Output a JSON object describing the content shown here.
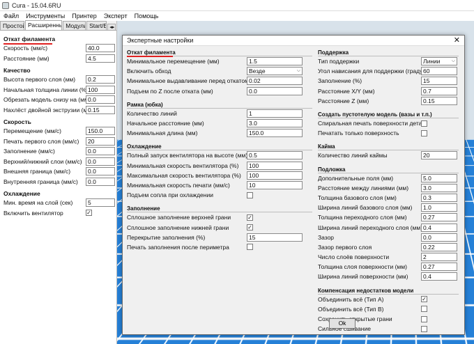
{
  "window": {
    "title": "Cura - 15.04.6RU"
  },
  "menu": [
    "Файл",
    "Инструменты",
    "Принтер",
    "Эксперт",
    "Помощь"
  ],
  "left_panel": {
    "tabs": [
      "Простой",
      "Расширенный",
      "Модули",
      "Start/E"
    ],
    "tab_arrows": "◂▸",
    "sections": [
      {
        "title": "Откат филамента",
        "rows": [
          {
            "label": "Скорость (мм/с)",
            "value": "40.0"
          },
          {
            "label": "Расстояние (мм)",
            "value": "4.5"
          }
        ]
      },
      {
        "title": "Качество",
        "rows": [
          {
            "label": "Высота первого слоя (мм)",
            "value": "0.2"
          },
          {
            "label": "Начальная толщина линии (%)",
            "value": "100"
          },
          {
            "label": "Обрезать модель снизу на (мм)",
            "value": "0.0"
          },
          {
            "label": "Нахлёст двойной экструзии (мм)",
            "value": "0.15"
          }
        ]
      },
      {
        "title": "Скорость",
        "rows": [
          {
            "label": "Перемещение (мм/с)",
            "value": "150.0"
          },
          {
            "label": "Печать первого слоя (мм/с)",
            "value": "20"
          },
          {
            "label": "Заполнение (мм/с)",
            "value": "0.0"
          },
          {
            "label": "Верхний/нижний слои (мм/с)",
            "value": "0.0"
          },
          {
            "label": "Внешняя граница (мм/с)",
            "value": "0.0"
          },
          {
            "label": "Внутренняя граница (мм/с)",
            "value": "0.0"
          }
        ]
      },
      {
        "title": "Охлаждение",
        "rows": [
          {
            "label": "Мин. время на слой (сек)",
            "value": "5"
          }
        ],
        "check": {
          "label": "Включить вентилятор",
          "checked": "✓"
        }
      }
    ]
  },
  "dialog": {
    "title": "Экспертные настройки",
    "close": "✕",
    "ok": "Ok",
    "left": {
      "retraction": {
        "title": "Откат филамента",
        "min_travel": {
          "label": "Минимальное перемещение (мм)",
          "value": "1.5"
        },
        "combing": {
          "label": "Включить обход",
          "value": "Везде"
        },
        "min_extrusion": {
          "label": "Минимальное выдавливание перед откатом (мм)",
          "value": "0.02"
        },
        "z_hop": {
          "label": "Подъем по Z после отката (мм)",
          "value": "0.0"
        }
      },
      "skirt": {
        "title": "Рамка (юбка)",
        "line_count": {
          "label": "Количество линий",
          "value": "1"
        },
        "start_distance": {
          "label": "Начальное расстояние (мм)",
          "value": "3.0"
        },
        "min_length": {
          "label": "Минимальная длина (мм)",
          "value": "150.0"
        }
      },
      "cooling": {
        "title": "Охлаждение",
        "fan_full_height": {
          "label": "Полный запуск вентилятора на высоте (мм)",
          "value": "0.5"
        },
        "fan_min": {
          "label": "Минимальная скорость вентилятора (%)",
          "value": "100"
        },
        "fan_max": {
          "label": "Максимальная скорость вентилятора (%)",
          "value": "100"
        },
        "min_speed": {
          "label": "Минимальная скорость печати (мм/с)",
          "value": "10"
        },
        "head_lift": {
          "label": "Подъем сопла при охлаждении",
          "checked": ""
        }
      },
      "infill": {
        "title": "Заполнение",
        "solid_top": {
          "label": "Сплошное заполнение верхней грани",
          "checked": "✓"
        },
        "solid_bottom": {
          "label": "Сплошное заполнение нижней грани",
          "checked": "✓"
        },
        "overlap": {
          "label": "Перекрытие заполнения (%)",
          "value": "15"
        },
        "after_perimeter": {
          "label": "Печать заполнения после периметра",
          "checked": ""
        }
      }
    },
    "right": {
      "support": {
        "title": "Поддержка",
        "type": {
          "label": "Тип поддержки",
          "value": "Линии"
        },
        "angle": {
          "label": "Угол нависания для поддержки (градусы)",
          "value": "60"
        },
        "fill": {
          "label": "Заполнение (%)",
          "value": "15"
        },
        "dist_xy": {
          "label": "Расстояние X/Y (мм)",
          "value": "0.7"
        },
        "dist_z": {
          "label": "Расстояние Z (мм)",
          "value": "0.15"
        }
      },
      "vase": {
        "title": "Создать пустотелую модель (вазы и т.п.)",
        "spiral": {
          "label": "Спиральная печать поверхности детали",
          "checked": ""
        },
        "surface_only": {
          "label": "Печатать только поверхность",
          "checked": ""
        }
      },
      "brim": {
        "title": "Кайма",
        "lines": {
          "label": "Количество линий каймы",
          "value": "20"
        }
      },
      "raft": {
        "title": "Подложка",
        "margin": {
          "label": "Дополнительные поля (мм)",
          "value": "5.0"
        },
        "line_spacing": {
          "label": "Расстояние между линиями (мм)",
          "value": "3.0"
        },
        "base_thickness": {
          "label": "Толщина базового слоя (мм)",
          "value": "0.3"
        },
        "base_width": {
          "label": "Ширина линий базового слоя (мм)",
          "value": "1.0"
        },
        "inter_thickness": {
          "label": "Толщина переходного слоя (мм)",
          "value": "0.27"
        },
        "inter_width": {
          "label": "Ширина линий переходного слоя (мм)",
          "value": "0.4"
        },
        "air_gap": {
          "label": "Зазор",
          "value": "0.0"
        },
        "first_gap": {
          "label": "Зазор первого слоя",
          "value": "0.22"
        },
        "surface_layers": {
          "label": "Число слоёв поверхности",
          "value": "2"
        },
        "surface_thickness": {
          "label": "Толщина слоя поверхности (мм)",
          "value": "0.27"
        },
        "surface_width": {
          "label": "Ширина линий поверхности (мм)",
          "value": "0.4"
        }
      },
      "fix": {
        "title": "Компенсация недостатков модели",
        "combine_a": {
          "label": "Объединить всё (Тип А)",
          "checked": "✓"
        },
        "combine_b": {
          "label": "Объединить всё (Тип B)",
          "checked": ""
        },
        "keep_open": {
          "label": "Сохранить открытые грани",
          "checked": ""
        },
        "extensive": {
          "label": "Сильное сшивание",
          "checked": ""
        }
      }
    }
  },
  "colors": {
    "accent_underline": "#e02020",
    "bed_blue": "#1b7ad6"
  }
}
